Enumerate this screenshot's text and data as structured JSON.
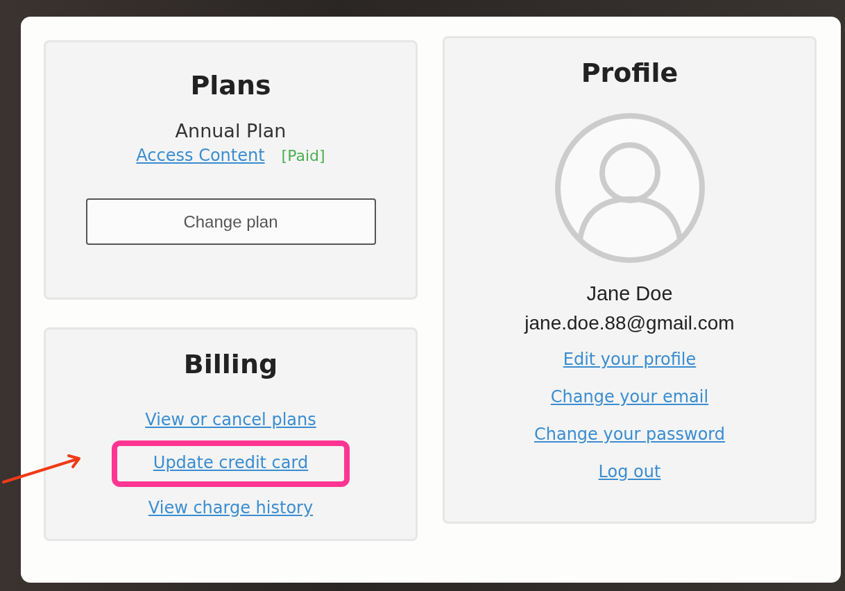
{
  "plans": {
    "title": "Plans",
    "plan_name": "Annual Plan",
    "link": "Access Content",
    "status": "[Paid]",
    "button": "Change plan"
  },
  "billing": {
    "title": "Billing",
    "links": [
      {
        "label": "View or cancel plans",
        "highlighted": false
      },
      {
        "label": "Update credit card",
        "highlighted": true
      },
      {
        "label": "View charge history",
        "highlighted": false
      }
    ]
  },
  "profile": {
    "title": "Profile",
    "name": "Jane Doe",
    "email": "jane.doe.88@gmail.com",
    "links": [
      "Edit your profile",
      "Change your email",
      "Change your password",
      "Log out"
    ]
  }
}
